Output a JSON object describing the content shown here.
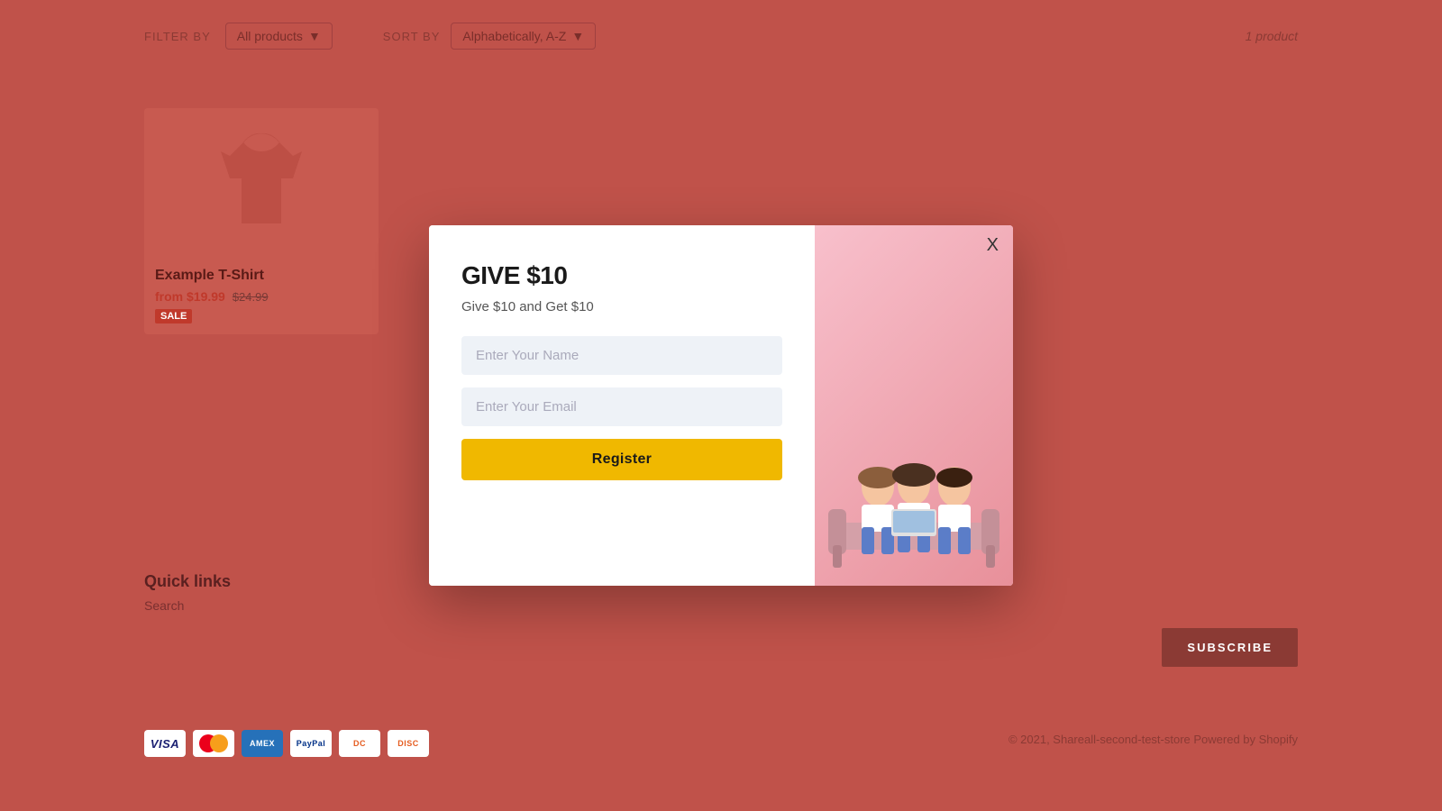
{
  "page": {
    "background_color": "#c0524a"
  },
  "topbar": {
    "filter_label": "FILTER BY",
    "filter_value": "All products",
    "sort_label": "SORT BY",
    "sort_value": "Alphabetically, A-Z",
    "product_count": "1 product"
  },
  "product": {
    "name": "Example T-Shirt",
    "price_new": "from $19.99",
    "price_old": "$24.99",
    "badge": "SALE"
  },
  "footer": {
    "quick_links_title": "Quick links",
    "search_link": "Search",
    "subscribe_label": "SUBSCRIBE",
    "copyright": "© 2021, Shareall-second-test-store  Powered by Shopify"
  },
  "modal": {
    "title": "GIVE $10",
    "subtitle": "Give $10 and Get $10",
    "name_placeholder": "Enter Your Name",
    "email_placeholder": "Enter Your Email",
    "register_label": "Register",
    "close_label": "X"
  }
}
